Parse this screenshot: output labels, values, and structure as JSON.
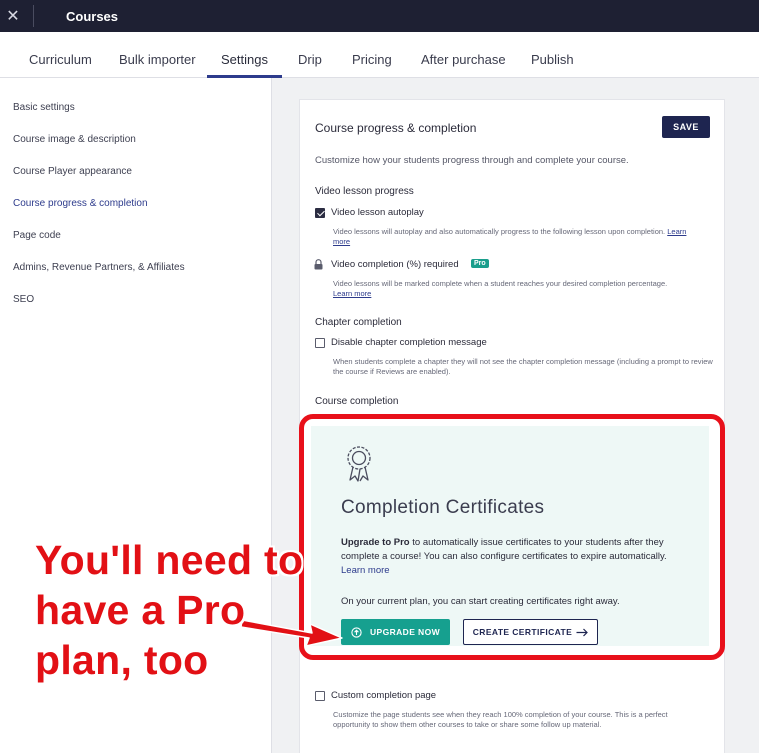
{
  "topbar": {
    "close_glyph": "✕",
    "title": "Courses"
  },
  "tabs": [
    {
      "label": "Curriculum"
    },
    {
      "label": "Bulk importer"
    },
    {
      "label": "Settings",
      "active": true
    },
    {
      "label": "Drip"
    },
    {
      "label": "Pricing"
    },
    {
      "label": "After purchase"
    },
    {
      "label": "Publish"
    }
  ],
  "sidebar": {
    "items": [
      {
        "label": "Basic settings"
      },
      {
        "label": "Course image & description"
      },
      {
        "label": "Course Player appearance"
      },
      {
        "label": "Course progress & completion",
        "active": true
      },
      {
        "label": "Page code"
      },
      {
        "label": "Admins, Revenue Partners, & Affiliates"
      },
      {
        "label": "SEO"
      }
    ]
  },
  "panel": {
    "title": "Course progress & completion",
    "save_label": "SAVE",
    "intro": "Customize how your students progress through and complete your course.",
    "video_section": {
      "heading": "Video lesson progress",
      "autoplay": {
        "label": "Video lesson autoplay",
        "checked": true,
        "help": "Video lessons will autoplay and also automatically progress to the following lesson upon completion.",
        "learn_more": "Learn more"
      },
      "completion": {
        "label": "Video completion (%) required",
        "badge": "Pro",
        "locked": true,
        "help": "Video lessons will be marked complete when a student reaches your desired completion percentage.",
        "learn_more": "Learn more"
      }
    },
    "chapter_section": {
      "heading": "Chapter completion",
      "disable_msg": {
        "label": "Disable chapter completion message",
        "checked": false,
        "help": "When students complete a chapter they will not see the chapter completion message (including a prompt to review the course if Reviews are enabled)."
      }
    },
    "course_section": {
      "heading": "Course completion",
      "certificates": {
        "icon": "award-ribbon-icon",
        "title": "Completion Certificates",
        "upgrade_bold": "Upgrade to Pro",
        "upgrade_text": " to automatically issue certificates to your students after they complete a course! You can also configure certificates to expire automatically.",
        "learn_more": "Learn more",
        "plan_text": "On your current plan, you can start creating certificates right away.",
        "upgrade_button": "UPGRADE NOW",
        "create_button": "CREATE CERTIFICATE"
      },
      "custom_page": {
        "label": "Custom completion page",
        "checked": false,
        "help": "Customize the page students see when they reach 100% completion of your course. This is a perfect opportunity to show them other courses to take or share some follow up material."
      }
    }
  },
  "annotation": {
    "lines": [
      "You'll need to",
      "have a Pro",
      "plan, too"
    ],
    "color": "#e21015"
  }
}
